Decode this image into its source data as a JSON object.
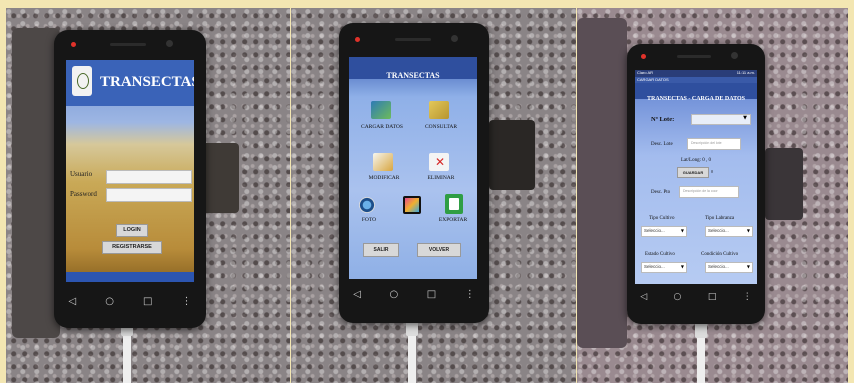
{
  "screen1": {
    "title": "TRANSECTAS",
    "usuario_label": "Usuario",
    "password_label": "Password",
    "login_button": "LOGIN",
    "register_button": "REGISTRARSE"
  },
  "screen2": {
    "title": "TRANSECTAS",
    "cargar_datos": "CARGAR DATOS",
    "consultar": "CONSULTAR",
    "modificar": "MODIFICAR",
    "eliminar": "ELIMINAR",
    "foto": "FOTO",
    "exportar": "EXPORTAR",
    "salir_button": "SALIR",
    "volver_button": "VOLVER"
  },
  "screen3": {
    "status_left": "Claro AR",
    "status_right": "11:11 a.m.",
    "app_bar": "CARGAR DATOS",
    "title": "TRANSECTAS - CARGA DE DATOS",
    "lote_label": "Nº Lote:",
    "desc_lote_label": "Desc. Lote",
    "desc_lote_placeholder": "Descripción del lote",
    "latlong": "Lat/Long: 0 , 0",
    "guardar_button": "GUARDAR",
    "guardar_value": "0",
    "desc_pto_label": "Desc. Pto",
    "desc_pto_placeholder": "Descripción de la coor",
    "tipo_cultivo_label": "Tipo Cultivo",
    "tipo_cultivo_value": "Seleccio...",
    "tipo_labranza_label": "Tipo Labranza",
    "tipo_labranza_value": "Seleccio...",
    "estado_cultivo_label": "Estado Cultivo",
    "estado_cultivo_value": "Seleccio...",
    "condicion_cultivo_label": "Condición Cultivo",
    "condicion_cultivo_value": "Seleccio..."
  },
  "nav_glyphs": {
    "back": "◁",
    "home": "○",
    "recent": "□",
    "more": "⋮"
  },
  "colors": {
    "border": "#f3e6b2",
    "screen_blue": "#2f4f9e",
    "screen_light": "#aac2ee",
    "led": "#e0322a"
  }
}
